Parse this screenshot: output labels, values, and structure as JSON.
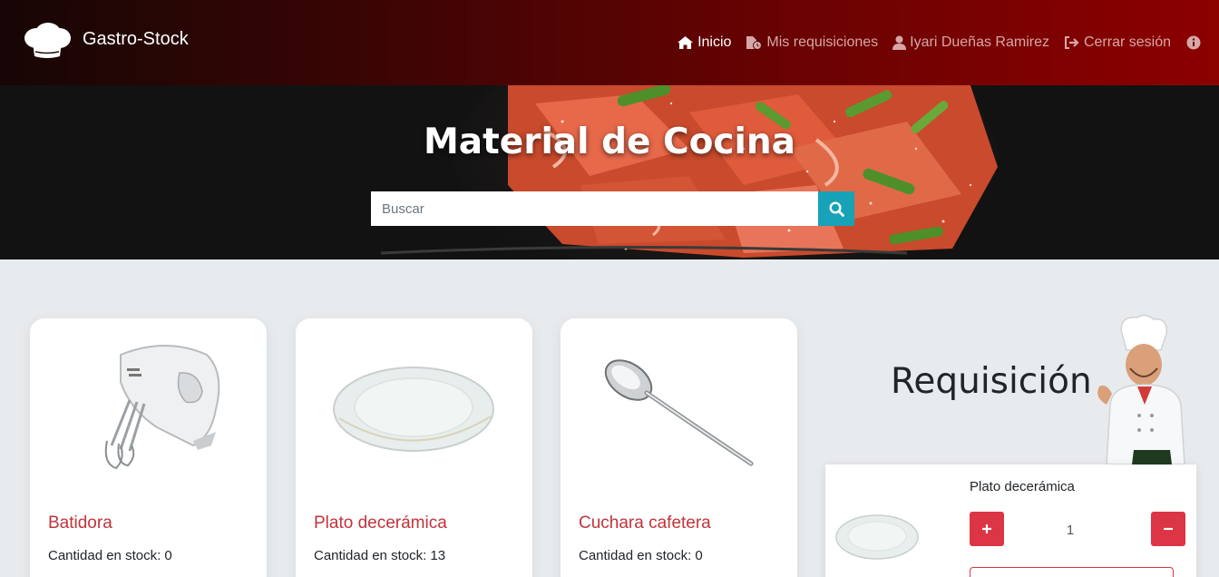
{
  "navbar": {
    "brand_name": "Gastro-Stock",
    "links": {
      "home": "Inicio",
      "requisitions": "Mis requisiciones",
      "user": "Iyari Dueñas Ramirez",
      "logout": "Cerrar sesión"
    }
  },
  "hero": {
    "title": "Material de Cocina",
    "search_placeholder": "Buscar"
  },
  "products": [
    {
      "name": "Batidora",
      "stock": "Cantidad en stock: 0"
    },
    {
      "name": "Plato decerámica",
      "stock": "Cantidad en stock: 13"
    },
    {
      "name": "Cuchara cafetera",
      "stock": "Cantidad en stock: 0"
    }
  ],
  "requisition": {
    "title": "Requisición",
    "item": {
      "name": "Plato decerámica",
      "quantity": "1"
    }
  },
  "colors": {
    "accent": "#c0343b",
    "button_red": "#dc3545",
    "search_button": "#17a2b8",
    "nav_gradient_end": "#8c0000"
  },
  "icons": [
    "chef-hat-icon",
    "home-icon",
    "file-clock-icon",
    "user-icon",
    "logout-icon",
    "info-icon",
    "search-icon",
    "plus-icon",
    "minus-icon"
  ]
}
